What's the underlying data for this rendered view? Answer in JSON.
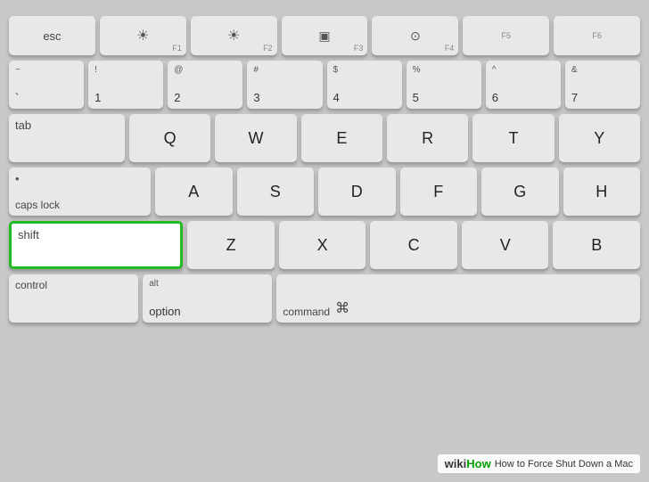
{
  "keyboard": {
    "rows": [
      {
        "id": "fn-row",
        "keys": [
          {
            "id": "esc",
            "label": "esc",
            "size": "regular"
          },
          {
            "id": "f1",
            "icon": "☀",
            "sublabel": "F1",
            "size": "regular"
          },
          {
            "id": "f2",
            "icon": "☀",
            "sublabel": "F2",
            "size": "regular"
          },
          {
            "id": "f3",
            "icon": "⊞",
            "sublabel": "F3",
            "size": "regular"
          },
          {
            "id": "f4",
            "icon": "⊙",
            "sublabel": "F4",
            "size": "regular"
          },
          {
            "id": "f5",
            "sublabel": "F5",
            "size": "regular"
          },
          {
            "id": "f6",
            "sublabel": "F6",
            "size": "regular"
          }
        ]
      },
      {
        "id": "number-row",
        "keys": [
          {
            "id": "tilde",
            "top": "~",
            "bottom": "`",
            "size": "regular"
          },
          {
            "id": "1",
            "top": "!",
            "bottom": "1",
            "size": "regular"
          },
          {
            "id": "2",
            "top": "@",
            "bottom": "2",
            "size": "regular"
          },
          {
            "id": "3",
            "top": "#",
            "bottom": "3",
            "size": "regular"
          },
          {
            "id": "4",
            "top": "$",
            "bottom": "4",
            "size": "regular"
          },
          {
            "id": "5",
            "top": "%",
            "bottom": "5",
            "size": "regular"
          },
          {
            "id": "6",
            "top": "^",
            "bottom": "6",
            "size": "regular"
          },
          {
            "id": "7",
            "top": "&",
            "bottom": "7",
            "size": "regular"
          }
        ]
      },
      {
        "id": "qwerty-row",
        "keys": [
          {
            "id": "tab",
            "label": "tab",
            "size": "wide"
          },
          {
            "id": "q",
            "letter": "Q",
            "size": "regular"
          },
          {
            "id": "w",
            "letter": "W",
            "size": "regular"
          },
          {
            "id": "e",
            "letter": "E",
            "size": "regular"
          },
          {
            "id": "r",
            "letter": "R",
            "size": "regular"
          },
          {
            "id": "t",
            "letter": "T",
            "size": "regular"
          },
          {
            "id": "y",
            "letter": "Y",
            "size": "regular"
          }
        ]
      },
      {
        "id": "asdf-row",
        "keys": [
          {
            "id": "caps",
            "label": "caps lock",
            "dot": "•",
            "size": "wider"
          },
          {
            "id": "a",
            "letter": "A",
            "size": "regular"
          },
          {
            "id": "s",
            "letter": "S",
            "size": "regular"
          },
          {
            "id": "d",
            "letter": "D",
            "size": "regular"
          },
          {
            "id": "f",
            "letter": "F",
            "size": "regular"
          },
          {
            "id": "g",
            "letter": "G",
            "size": "regular"
          },
          {
            "id": "h",
            "letter": "H",
            "size": "regular"
          }
        ]
      },
      {
        "id": "zxcv-row",
        "keys": [
          {
            "id": "shift",
            "label": "shift",
            "size": "shift",
            "highlighted": true
          },
          {
            "id": "z",
            "letter": "Z",
            "size": "regular"
          },
          {
            "id": "x",
            "letter": "X",
            "size": "regular"
          },
          {
            "id": "c",
            "letter": "C",
            "size": "regular"
          },
          {
            "id": "v",
            "letter": "V",
            "size": "regular"
          },
          {
            "id": "b",
            "letter": "B",
            "size": "regular"
          }
        ]
      },
      {
        "id": "bottom-row",
        "keys": [
          {
            "id": "control",
            "label": "control",
            "size": "regular"
          },
          {
            "id": "option",
            "top": "alt",
            "bottom": "option",
            "size": "regular"
          },
          {
            "id": "command",
            "label": "command",
            "icon": "⌘",
            "size": "widest"
          }
        ]
      }
    ],
    "badge": {
      "wiki": "wiki",
      "how": "How",
      "desc": "How to Force Shut Down a Mac"
    }
  }
}
